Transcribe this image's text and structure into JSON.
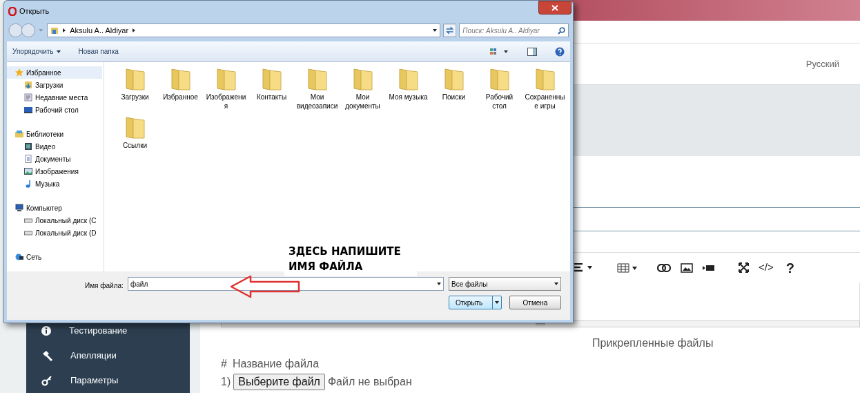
{
  "page": {
    "language": "Русский",
    "sidebar": [
      {
        "label": "Тестирование",
        "kind": "info"
      },
      {
        "label": "Апелляции",
        "kind": "gavel"
      },
      {
        "label": "Параметры",
        "kind": "key"
      }
    ],
    "editor_glyphs": [
      "</>",
      "?"
    ],
    "attachments_title": "Прикрепленные файлы",
    "file_header": {
      "hash": "#",
      "label": "Название файла"
    },
    "file_row": {
      "number": "1)",
      "button": "Выберите файл",
      "status": "Файл не выбран"
    }
  },
  "dialog": {
    "title": "Открыть",
    "breadcrumb": "Aksulu A.. Aldiyar",
    "search_placeholder": "Поиск: Aksulu A.. Aldiyar",
    "toolbar": [
      "Упорядочить",
      "Новая папка"
    ],
    "nav": [
      {
        "label": "Избранное",
        "kind": "star",
        "selected": true,
        "children": [
          {
            "label": "Загрузки",
            "kind": "download",
            "selected": false
          },
          {
            "label": "Недавние места",
            "kind": "recent",
            "selected": false
          },
          {
            "label": "Рабочий стол",
            "kind": "desktop",
            "selected": false
          }
        ]
      },
      {
        "label": "Библиотеки",
        "kind": "library",
        "selected": false,
        "children": [
          {
            "label": "Видео",
            "kind": "video",
            "selected": false
          },
          {
            "label": "Документы",
            "kind": "document",
            "selected": false
          },
          {
            "label": "Изображения",
            "kind": "image",
            "selected": false
          },
          {
            "label": "Музыка",
            "kind": "music",
            "selected": false
          }
        ]
      },
      {
        "label": "Компьютер",
        "kind": "computer",
        "selected": false,
        "children": [
          {
            "label": "Локальный диск (C",
            "kind": "drive",
            "selected": false
          },
          {
            "label": "Локальный диск (D",
            "kind": "drive",
            "selected": false
          }
        ]
      },
      {
        "label": "Сеть",
        "kind": "network",
        "selected": false
      }
    ],
    "folders": [
      "Загрузки",
      "Избранное",
      "Изображения",
      "Контакты",
      "Мои видеозаписи",
      "Мои документы",
      "Моя музыка",
      "Поиски",
      "Рабочий стол",
      "Сохраненные игры",
      "Ссылки"
    ],
    "filename_label": "Имя файла:",
    "filename_value": "файл",
    "filter": "Все файлы",
    "buttons": [
      "Открыть",
      "Отмена"
    ]
  },
  "annotation": {
    "lines": [
      "ЗДЕСЬ НАПИШИТЕ",
      "ИМЯ ФАЙЛА"
    ]
  }
}
